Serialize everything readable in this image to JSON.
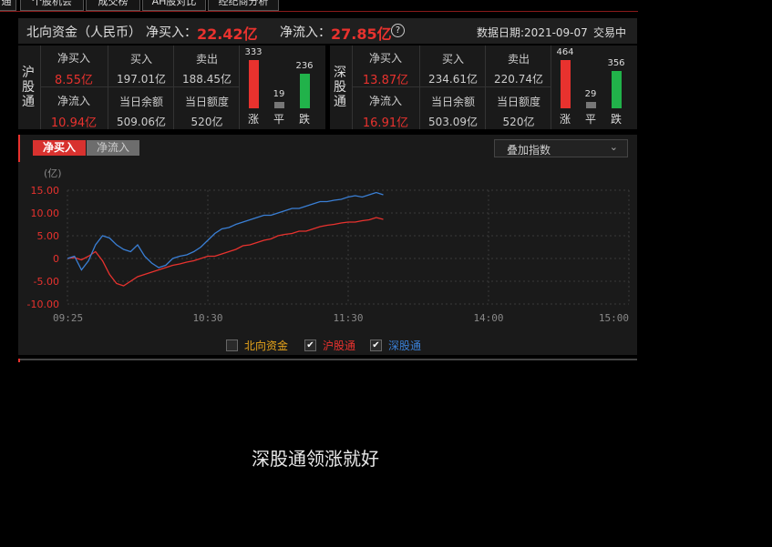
{
  "tabs": [
    "通",
    "个股机会",
    "成交榜",
    "AH股对比",
    "经纪商分析"
  ],
  "header": {
    "title": "北向资金（人民币）",
    "net_buy_label": "净买入：",
    "net_buy_value": "22.42亿",
    "net_inflow_label": "净流入：",
    "net_inflow_value": "27.85亿",
    "help_icon": "question-circle-icon",
    "date_label": "数据日期:2021-09-07",
    "status": "交易中"
  },
  "sh": {
    "name": "沪股通",
    "net_buy_label": "净买入",
    "net_buy_value": "8.55亿",
    "buy_label": "买入",
    "buy_value": "197.01亿",
    "sell_label": "卖出",
    "sell_value": "188.45亿",
    "net_inflow_label": "净流入",
    "net_inflow_value": "10.94亿",
    "balance_label": "当日余额",
    "balance_value": "509.06亿",
    "quota_label": "当日额度",
    "quota_value": "520亿",
    "up_count": "333",
    "flat_count": "19",
    "down_count": "236",
    "up_label": "涨",
    "flat_label": "平",
    "down_label": "跌"
  },
  "sz": {
    "name": "深股通",
    "net_buy_label": "净买入",
    "net_buy_value": "13.87亿",
    "buy_label": "买入",
    "buy_value": "234.61亿",
    "sell_label": "卖出",
    "sell_value": "220.74亿",
    "net_inflow_label": "净流入",
    "net_inflow_value": "16.91亿",
    "balance_label": "当日余额",
    "balance_value": "503.09亿",
    "quota_label": "当日额度",
    "quota_value": "520亿",
    "up_count": "464",
    "flat_count": "29",
    "down_count": "356",
    "up_label": "涨",
    "flat_label": "平",
    "down_label": "跌"
  },
  "chart_controls": {
    "btn_net_buy": "净买入",
    "btn_net_inflow": "净流入",
    "overlay_select": "叠加指数",
    "unit": "(亿)"
  },
  "legend": {
    "north": "北向资金",
    "north_checked": false,
    "sh": "沪股通",
    "sh_checked": true,
    "sz": "深股通",
    "sz_checked": true
  },
  "caption": "深股通领涨就好",
  "colors": {
    "red": "#e8322e",
    "green": "#21b24a",
    "blue": "#3a7fd5",
    "north": "#e8a41a"
  },
  "chart_data": {
    "type": "line",
    "title": "",
    "xlabel": "",
    "ylabel": "(亿)",
    "xlim_minutes": [
      0,
      240
    ],
    "x_ticks": [
      "09:25",
      "10:30",
      "11:30",
      "14:00",
      "15:00"
    ],
    "x_tick_minutes": [
      0,
      60,
      120,
      180,
      240
    ],
    "ylim": [
      -10,
      15
    ],
    "y_ticks": [
      "15.00",
      "10.00",
      "5.00",
      "0",
      "-5.00",
      "-10.00"
    ],
    "y_tick_values": [
      15,
      10,
      5,
      0,
      -5,
      -10
    ],
    "grid": true,
    "series": [
      {
        "name": "沪股通",
        "color": "#e8322e",
        "x_minutes": [
          0,
          3,
          6,
          9,
          12,
          15,
          18,
          21,
          24,
          27,
          30,
          33,
          36,
          39,
          42,
          45,
          48,
          51,
          54,
          57,
          60,
          63,
          66,
          69,
          72,
          75,
          78,
          81,
          84,
          87,
          90,
          93,
          96,
          99,
          102,
          105,
          108,
          111,
          114,
          117,
          120,
          123,
          126,
          129,
          132,
          135
        ],
        "values": [
          0,
          0.2,
          -0.3,
          0.5,
          1.5,
          -0.5,
          -3.5,
          -5.5,
          -6,
          -5,
          -4,
          -3.5,
          -3,
          -2.5,
          -2,
          -1.5,
          -1.2,
          -0.8,
          -0.5,
          0,
          0.5,
          0.5,
          1,
          1.5,
          2,
          2.8,
          3,
          3.5,
          4,
          4.3,
          5,
          5.3,
          5.5,
          6,
          6,
          6.5,
          7,
          7.3,
          7.5,
          7.8,
          8,
          8,
          8.3,
          8.5,
          9,
          8.6
        ]
      },
      {
        "name": "深股通",
        "color": "#3a7fd5",
        "x_minutes": [
          0,
          3,
          6,
          9,
          12,
          15,
          18,
          21,
          24,
          27,
          30,
          33,
          36,
          39,
          42,
          45,
          48,
          51,
          54,
          57,
          60,
          63,
          66,
          69,
          72,
          75,
          78,
          81,
          84,
          87,
          90,
          93,
          96,
          99,
          102,
          105,
          108,
          111,
          114,
          117,
          120,
          123,
          126,
          129,
          132,
          135
        ],
        "values": [
          0,
          0.5,
          -2.5,
          -0.5,
          3,
          5,
          4.5,
          3,
          2,
          1.5,
          3,
          0.5,
          -1,
          -2,
          -1.5,
          0,
          0.5,
          0.8,
          1.5,
          2.5,
          4,
          5.5,
          6.5,
          6.8,
          7.5,
          8,
          8.5,
          9,
          9.5,
          9.5,
          10,
          10.5,
          11,
          11,
          11.5,
          12,
          12.5,
          12.5,
          12.8,
          13,
          13.5,
          13.8,
          13.5,
          14,
          14.5,
          14
        ]
      }
    ]
  }
}
